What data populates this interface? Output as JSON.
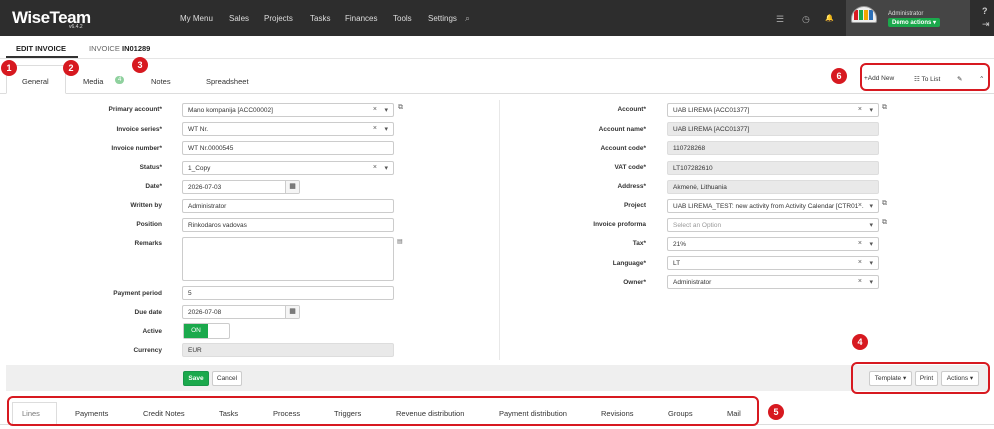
{
  "app": {
    "logo": "WiseTeam",
    "version": "v6.4.2",
    "menu": [
      "My Menu",
      "Sales",
      "Projects",
      "Tasks",
      "Finances",
      "Tools",
      "Settings"
    ],
    "user": "Administrator",
    "demo_button": "Demo actions ▾"
  },
  "icons": {
    "search": "⌕",
    "list": "☰",
    "clock": "◷",
    "bell": "🔔",
    "help": "?",
    "logout": "⇥"
  },
  "page": {
    "edit_title": "EDIT INVOICE",
    "invoice_prefix": "INVOICE",
    "invoice_no": "IN01289"
  },
  "tabs": [
    "General",
    "Media",
    "Notes",
    "Spreadsheet"
  ],
  "media_count": "4",
  "toolbar": {
    "add_new": "+Add New",
    "to_list": "☷ To List",
    "edit": "✎",
    "collapse": "⌃"
  },
  "left_labels": {
    "primary_account": "Primary account*",
    "invoice_series": "Invoice series*",
    "invoice_number": "Invoice number*",
    "status": "Status*",
    "date": "Date*",
    "written_by": "Written by",
    "position": "Position",
    "remarks": "Remarks",
    "payment_period": "Payment period",
    "due_date": "Due date",
    "active": "Active",
    "currency": "Currency"
  },
  "left_values": {
    "primary_account": "Mano kompanija [ACC00002]",
    "invoice_series": "WT Nr.",
    "invoice_number": "WT Nr.0000545",
    "status": "1_Copy",
    "date": "2026-07-03",
    "written_by": "Administrator",
    "position": "Rinkodaros vadovas",
    "payment_period": "5",
    "due_date": "2026-07-08",
    "active": "ON",
    "currency": "EUR"
  },
  "right_labels": {
    "account": "Account*",
    "account_name": "Account name*",
    "account_code": "Account code*",
    "vat_code": "VAT code*",
    "address": "Address*",
    "project": "Project",
    "invoice_proforma": "Invoice proforma",
    "tax": "Tax*",
    "language": "Language*",
    "owner": "Owner*"
  },
  "right_values": {
    "account": "UAB LIREMA [ACC01377]",
    "account_name": "UAB LIREMA [ACC01377]",
    "account_code": "110728268",
    "vat_code": "LT107282610",
    "address": "Akmenė, Lithuania",
    "project": "UAB LIREMA_TEST: new activity from Activity Calendar [CTR01...",
    "invoice_proforma_placeholder": "Select an Option",
    "tax": "21%",
    "language": "LT",
    "owner": "Administrator"
  },
  "actions": {
    "save": "Save",
    "cancel": "Cancel",
    "template": "Template ▾",
    "print": "Print",
    "actions": "Actions ▾"
  },
  "bottom_tabs": [
    "Lines",
    "Payments",
    "Credit Notes",
    "Tasks",
    "Process",
    "Triggers",
    "Revenue distribution",
    "Payment distribution",
    "Revisions",
    "Groups",
    "Mail"
  ],
  "markers": [
    "1",
    "2",
    "3",
    "4",
    "5",
    "6"
  ],
  "colors": {
    "nav": "#2d2d2d",
    "accent_green": "#1ba94c",
    "marker_red": "#d71920"
  }
}
